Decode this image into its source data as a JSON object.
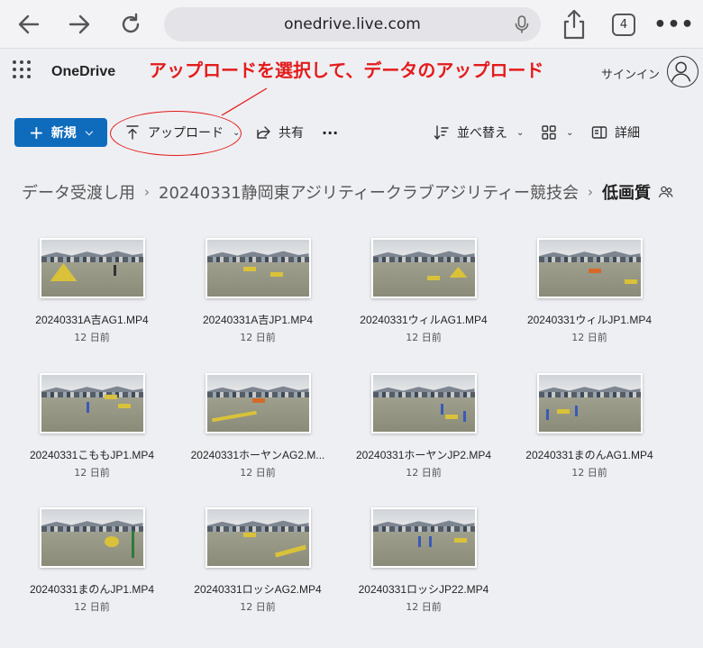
{
  "browser": {
    "url": "onedrive.live.com",
    "tab_count": "4",
    "more": "•••"
  },
  "header": {
    "app_name": "OneDrive",
    "signin": "サインイン",
    "annotation": "アップロードを選択して、データのアップロード"
  },
  "toolbar": {
    "new_label": "新規",
    "upload_label": "アップロード",
    "share_label": "共有",
    "more_label": "···",
    "sort_label": "並べ替え",
    "details_label": "詳細"
  },
  "breadcrumb": {
    "items": [
      "データ受渡し用",
      "20240331静岡東アジリティークラブアジリティー競技会"
    ],
    "current": "低画質"
  },
  "files": [
    {
      "name": "20240331A吉AG1.MP4",
      "date": "12 日前"
    },
    {
      "name": "20240331A吉JP1.MP4",
      "date": "12 日前"
    },
    {
      "name": "20240331ウィルAG1.MP4",
      "date": "12 日前"
    },
    {
      "name": "20240331ウィルJP1.MP4",
      "date": "12 日前"
    },
    {
      "name": "20240331こももJP1.MP4",
      "date": "12 日前"
    },
    {
      "name": "20240331ホーヤンAG2.M...",
      "date": "12 日前"
    },
    {
      "name": "20240331ホーヤンJP2.MP4",
      "date": "12 日前"
    },
    {
      "name": "20240331まのんAG1.MP4",
      "date": "12 日前"
    },
    {
      "name": "20240331まのんJP1.MP4",
      "date": "12 日前"
    },
    {
      "name": "20240331ロッシAG2.MP4",
      "date": "12 日前"
    },
    {
      "name": "20240331ロッシJP22.MP4",
      "date": "12 日前"
    }
  ],
  "colors": {
    "accent": "#0f6cbd",
    "annotation": "#e41b1b"
  }
}
